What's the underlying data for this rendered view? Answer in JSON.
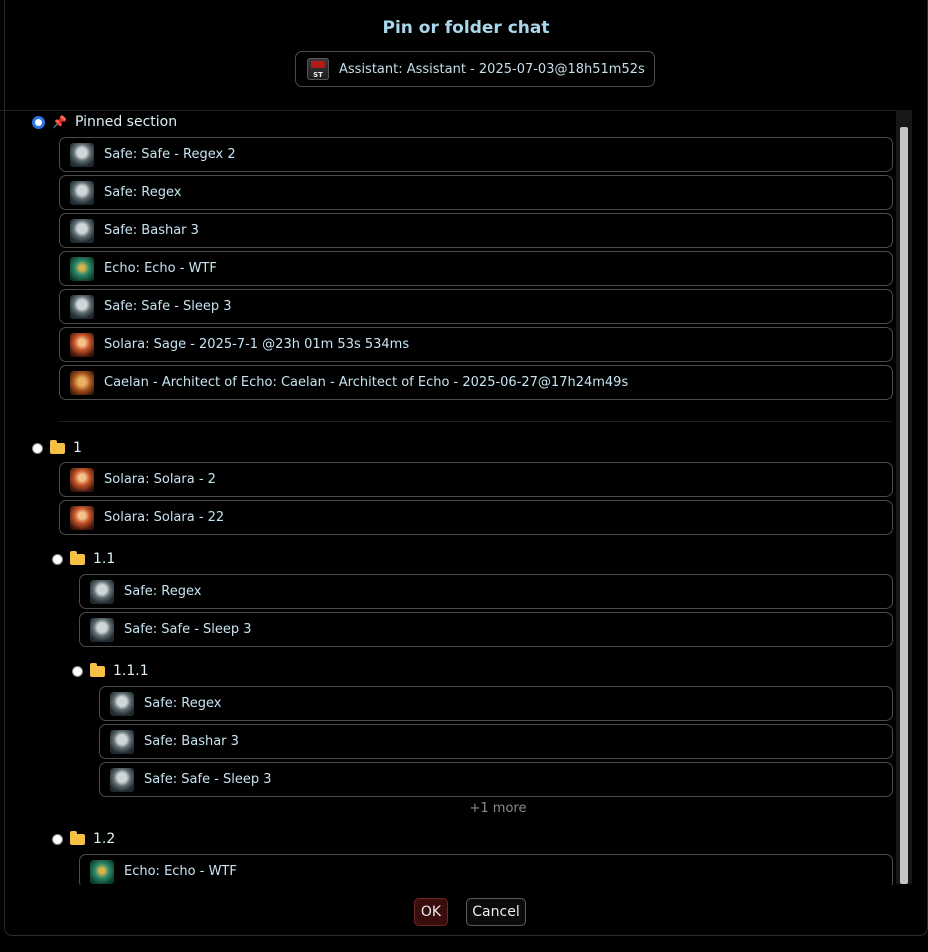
{
  "dialog": {
    "title": "Pin or folder chat",
    "current_chat": "Assistant: Assistant - 2025-07-03@18h51m52s",
    "badge_text": "ST"
  },
  "pinned": {
    "label": "Pinned section",
    "selected": true,
    "items": [
      {
        "label": "Safe: Safe - Regex 2",
        "avatar": "safe"
      },
      {
        "label": "Safe: Regex",
        "avatar": "safe"
      },
      {
        "label": "Safe: Bashar 3",
        "avatar": "safe"
      },
      {
        "label": "Echo: Echo - WTF",
        "avatar": "echo"
      },
      {
        "label": "Safe: Safe - Sleep 3",
        "avatar": "safe"
      },
      {
        "label": "Solara: Sage - 2025-7-1 @23h 01m 53s 534ms",
        "avatar": "solara"
      },
      {
        "label": "Caelan - Architect of Echo: Caelan - Architect of Echo - 2025-06-27@17h24m49s",
        "avatar": "caelan"
      }
    ]
  },
  "folders": {
    "f1": {
      "label": "1",
      "items": [
        {
          "label": "Solara: Solara - 2",
          "avatar": "solara"
        },
        {
          "label": "Solara: Solara - 22",
          "avatar": "solara"
        }
      ]
    },
    "f1_1": {
      "label": "1.1",
      "items": [
        {
          "label": "Safe: Regex",
          "avatar": "safe"
        },
        {
          "label": "Safe: Safe - Sleep 3",
          "avatar": "safe"
        }
      ]
    },
    "f1_1_1": {
      "label": "1.1.1",
      "items": [
        {
          "label": "Safe: Regex",
          "avatar": "safe"
        },
        {
          "label": "Safe: Bashar 3",
          "avatar": "safe"
        },
        {
          "label": "Safe: Safe - Sleep 3",
          "avatar": "safe"
        }
      ],
      "more": "+1 more"
    },
    "f1_2": {
      "label": "1.2",
      "items": [
        {
          "label": "Echo: Echo - WTF",
          "avatar": "echo"
        }
      ]
    }
  },
  "buttons": {
    "ok": "OK",
    "cancel": "Cancel"
  }
}
